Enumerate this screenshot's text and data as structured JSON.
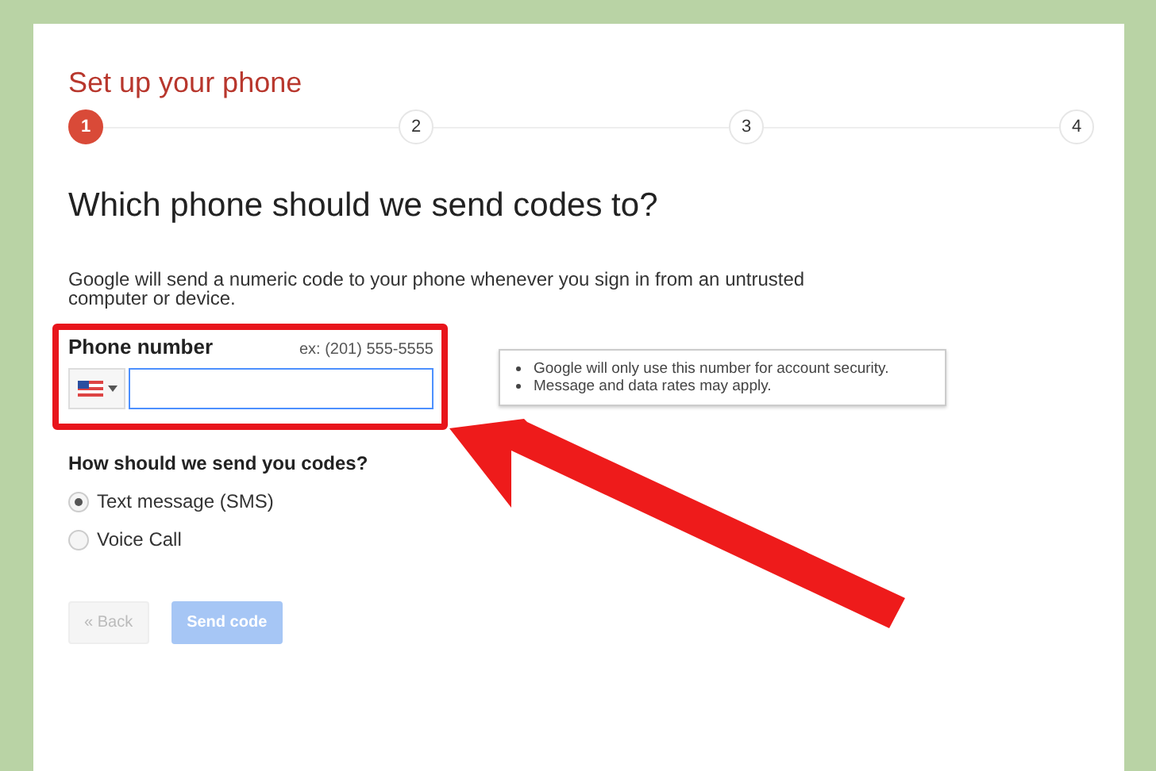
{
  "title": "Set up your phone",
  "steps": [
    {
      "label": "1",
      "selected": true
    },
    {
      "label": "2",
      "selected": false
    },
    {
      "label": "3",
      "selected": false
    },
    {
      "label": "4",
      "selected": false
    }
  ],
  "heading": "Which phone should we send codes to?",
  "intro": "Google will send a numeric code to your phone whenever you sign in from an untrusted computer or device.",
  "phone": {
    "label": "Phone number",
    "example": "ex: (201) 555-5555"
  },
  "tooltip": [
    "Google will only use this number for account security.",
    "Message and data rates may apply."
  ],
  "method_question": "How should we send you codes?",
  "methods": [
    {
      "label": "Text message (SMS)",
      "selected": true
    },
    {
      "label": "Voice Call",
      "selected": false
    }
  ],
  "buttons": [
    {
      "label": "« Back",
      "kind": "secondary",
      "disabled": true
    },
    {
      "label": "Send code",
      "kind": "primary",
      "disabled": true
    }
  ]
}
